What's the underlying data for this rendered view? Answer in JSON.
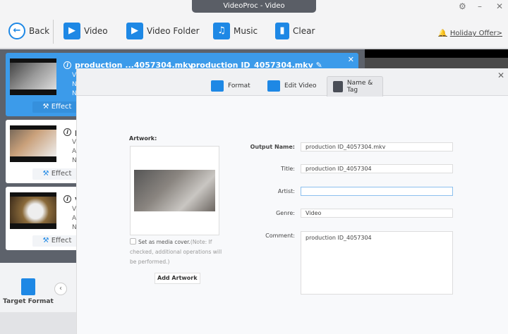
{
  "window": {
    "title": "VideoProc - Video",
    "settings": "⚙",
    "minimize": "–",
    "close": "✕"
  },
  "toolbar": {
    "back": "Back",
    "video": "Video",
    "video_folder": "Video Folder",
    "music": "Music",
    "clear": "Clear",
    "offer": "Holiday Offer>"
  },
  "cards": [
    {
      "name": "production ...4057304.mkv",
      "output": "production ID_4057304.mkv",
      "meta": [
        "Vide",
        "No A",
        "No S"
      ],
      "effect": "Effect"
    },
    {
      "name": "pe",
      "meta": [
        "Vide",
        "Audi",
        "No S"
      ],
      "effect": "Effect"
    },
    {
      "name": "vi",
      "meta": [
        "Vide",
        "Audi",
        "No S"
      ],
      "effect": "Effect"
    }
  ],
  "bottom": {
    "target_format": "Target Format"
  },
  "dialog": {
    "tabs": [
      "Format",
      "Edit Video",
      "Name & Tag"
    ],
    "active_tab": "Name & Tag",
    "artwork_label": "Artwork:",
    "cover_label": "Set as media cover.",
    "cover_note": "(Note: If checked, additional operations will be performed.)",
    "add_artwork": "Add Artwork",
    "fields": {
      "output_name": {
        "label": "Output Name:",
        "value": "production ID_4057304.mkv"
      },
      "title": {
        "label": "Title:",
        "value": "production ID_4057304"
      },
      "artist": {
        "label": "Artist:",
        "value": ""
      },
      "genre": {
        "label": "Genre:",
        "value": "Video"
      },
      "comment": {
        "label": "Comment:",
        "value": "production ID_4057304"
      }
    }
  },
  "colors": {
    "accent": "#1e88e5",
    "selected_card": "#3c9bea",
    "offer": "#f26522"
  }
}
